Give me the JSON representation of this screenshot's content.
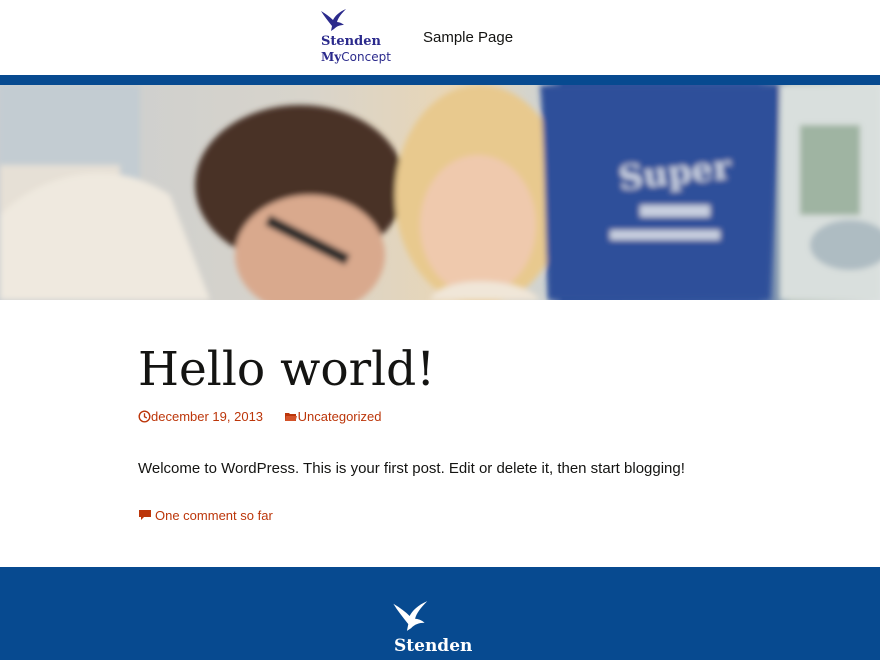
{
  "header": {
    "logo_line1": "Stenden",
    "logo_line2_bold": "My",
    "logo_line2_rest": "Concept",
    "nav_items": [
      {
        "label": "Sample Page"
      }
    ]
  },
  "post": {
    "title": "Hello world!",
    "date": "december 19, 2013",
    "category": "Uncategorized",
    "body": "Welcome to WordPress. This is your first post. Edit or delete it, then start blogging!",
    "comments_link": "One comment so far"
  },
  "footer": {
    "brand": "Stenden"
  },
  "colors": {
    "brand_blue": "#074a90",
    "logo_purple": "#2b2a8c",
    "link_orange": "#bc360a",
    "text": "#141412"
  },
  "icons": {
    "logo": "swallow-bird-icon",
    "date": "clock-icon",
    "category": "folder-icon",
    "comments": "speech-bubble-icon"
  }
}
